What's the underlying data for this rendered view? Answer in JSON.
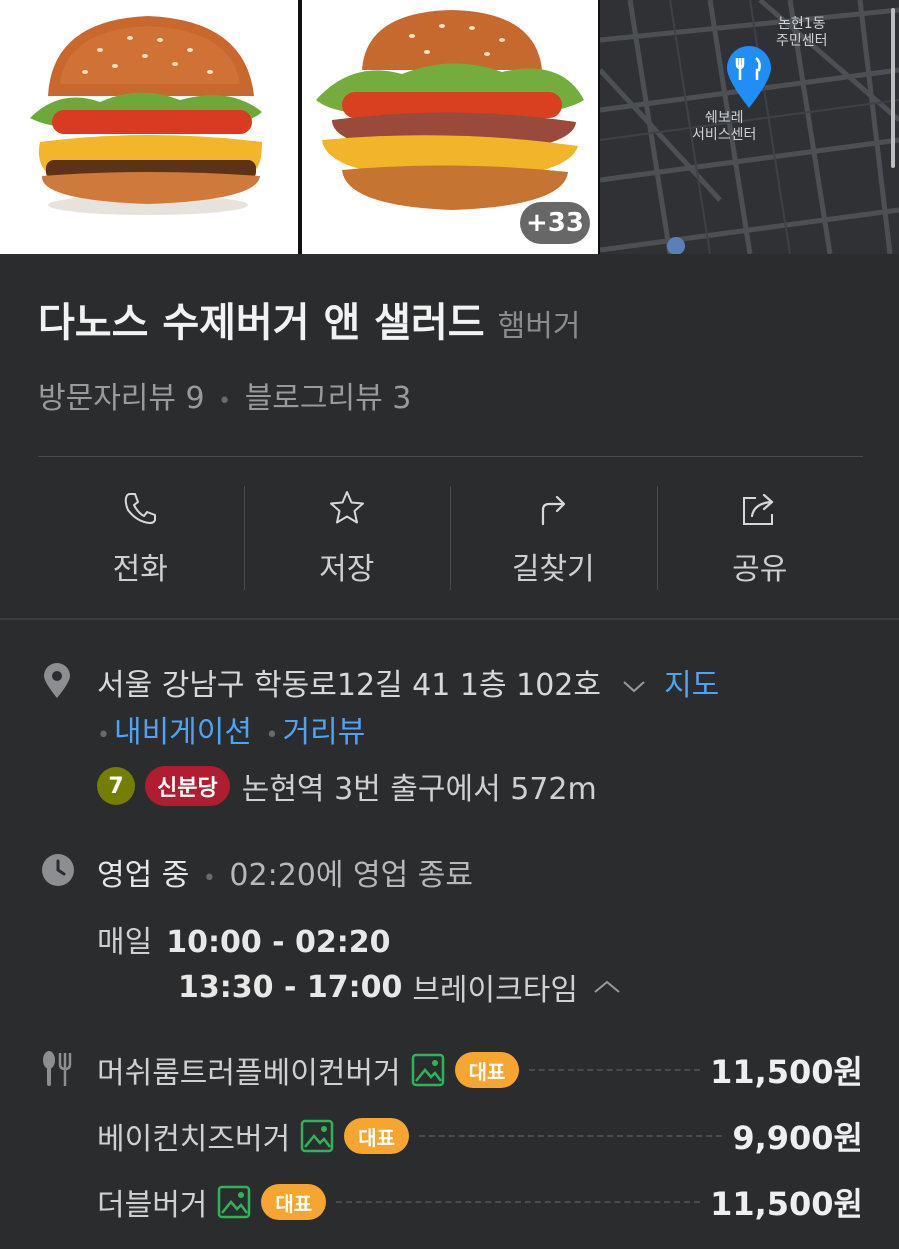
{
  "photos": {
    "more_count": "+33"
  },
  "map_thumb": {
    "label_top": "논현1동\n주민센터",
    "label_mid": "쉐보레\n서비스센터"
  },
  "place": {
    "name": "다노스 수제버거 앤 샐러드",
    "category": "햄버거"
  },
  "reviews": {
    "visitor": "방문자리뷰 9",
    "blog": "블로그리뷰 3"
  },
  "actions": [
    {
      "label": "전화",
      "icon": "phone-icon"
    },
    {
      "label": "저장",
      "icon": "star-icon"
    },
    {
      "label": "길찾기",
      "icon": "directions-icon"
    },
    {
      "label": "공유",
      "icon": "share-icon"
    }
  ],
  "address": {
    "text": "서울 강남구 학동로12길 41 1층 102호",
    "map_link": "지도",
    "nav_link": "내비게이션",
    "street_link": "거리뷰"
  },
  "subway": {
    "line_number": "7",
    "line_name": "신분당",
    "station_text": "논현역 3번 출구에서 572m"
  },
  "hours": {
    "status": "영업 중",
    "closing": "02:20에 영업 종료",
    "day": "매일",
    "time": "10:00 - 02:20",
    "break_time": "13:30 - 17:00",
    "break_label": "브레이크타임"
  },
  "menu": [
    {
      "name": "머쉬룸트러플베이컨버거",
      "badge": "대표",
      "price": "11,500원"
    },
    {
      "name": "베이컨치즈버거",
      "badge": "대표",
      "price": "9,900원"
    },
    {
      "name": "더블버거",
      "badge": "대표",
      "price": "11,500원"
    }
  ],
  "colors": {
    "link": "#4fa3f7",
    "badge": "#f6a531",
    "line7": "#747f00",
    "shinbundang": "#b11d30",
    "pin": "#1f8ff5"
  }
}
